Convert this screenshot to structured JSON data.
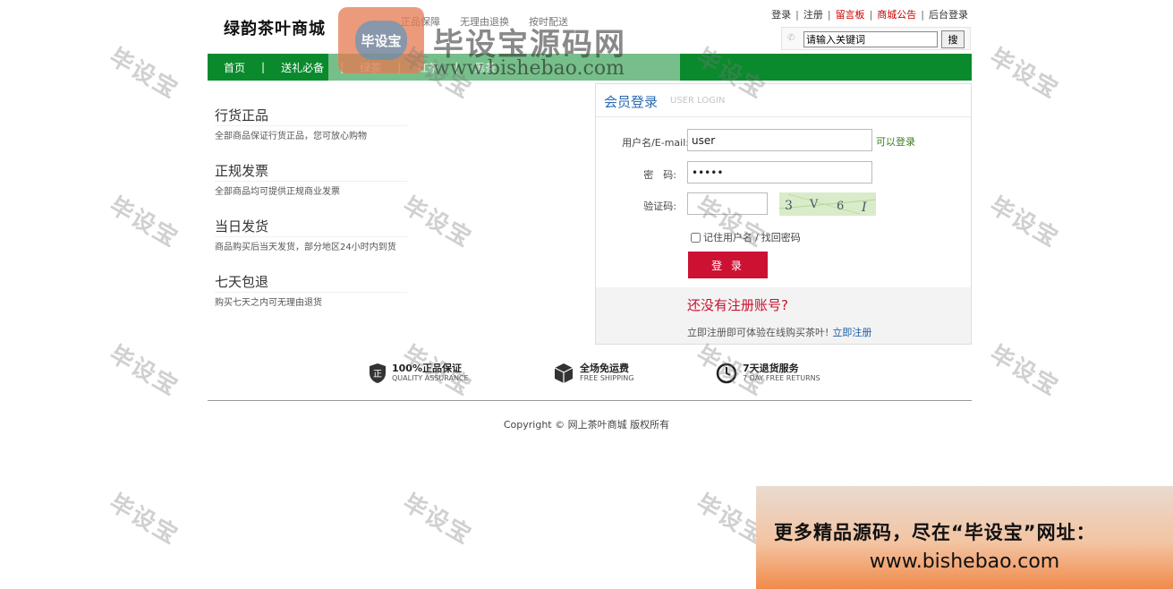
{
  "header": {
    "logo": "绿韵茶叶商城",
    "slogans": [
      "正品保障",
      "无理由退换",
      "按时配送"
    ],
    "links": [
      {
        "label": "登录",
        "color": "#333333"
      },
      {
        "label": "注册",
        "color": "#333333"
      },
      {
        "label": "留言板",
        "color": "#cc0000"
      },
      {
        "label": "商城公告",
        "color": "#cc0000"
      },
      {
        "label": "后台登录",
        "color": "#333333"
      }
    ],
    "search": {
      "value": "请输入关键词",
      "button": "搜"
    }
  },
  "nav": {
    "items": [
      "首页",
      "送礼必备",
      "绿茶",
      "红茶",
      "黑茶"
    ],
    "color": "#0a8a2d"
  },
  "features": [
    {
      "title": "行货正品",
      "desc": "全部商品保证行货正品，您可放心购物"
    },
    {
      "title": "正规发票",
      "desc": "全部商品均可提供正规商业发票"
    },
    {
      "title": "当日发货",
      "desc": "商品购买后当天发货，部分地区24小时内到货"
    },
    {
      "title": "七天包退",
      "desc": "购买七天之内可无理由退货"
    }
  ],
  "login": {
    "title": "会员登录",
    "subtitle": "USER LOGIN",
    "username_label": "用户名/E-mail:",
    "username_value": "user",
    "username_hint": "可以登录",
    "password_label": "密　码:",
    "password_value": "•••••",
    "captcha_label": "验证码:",
    "captcha_value": "",
    "captcha_chars": [
      "3",
      "V",
      "6",
      "I"
    ],
    "remember_label": "记住用户名",
    "forgot_label": "找回密码",
    "submit": "登 录",
    "register_question": "还没有注册账号?",
    "register_desc": "立即注册即可体验在线购买茶叶!",
    "register_link": "立即注册"
  },
  "services": [
    {
      "icon": "shield-icon",
      "title": "100%正品保证",
      "sub": "QUALITY ASSURANCE"
    },
    {
      "icon": "box-icon",
      "title": "全场免运费",
      "sub": "FREE SHIPPING"
    },
    {
      "icon": "clock-icon",
      "title": "7天退货服务",
      "sub": "7 DAY FREE RETURNS"
    }
  ],
  "footer": {
    "copyright": "Copyright © 网上茶叶商城 版权所有"
  },
  "watermark": {
    "mark": "毕设宝",
    "brand": "毕设宝源码网",
    "url": "www.bishebao.com",
    "ad_line1": "更多精品源码，尽在“毕设宝”网址：",
    "ad_line2": "www.bishebao.com"
  }
}
